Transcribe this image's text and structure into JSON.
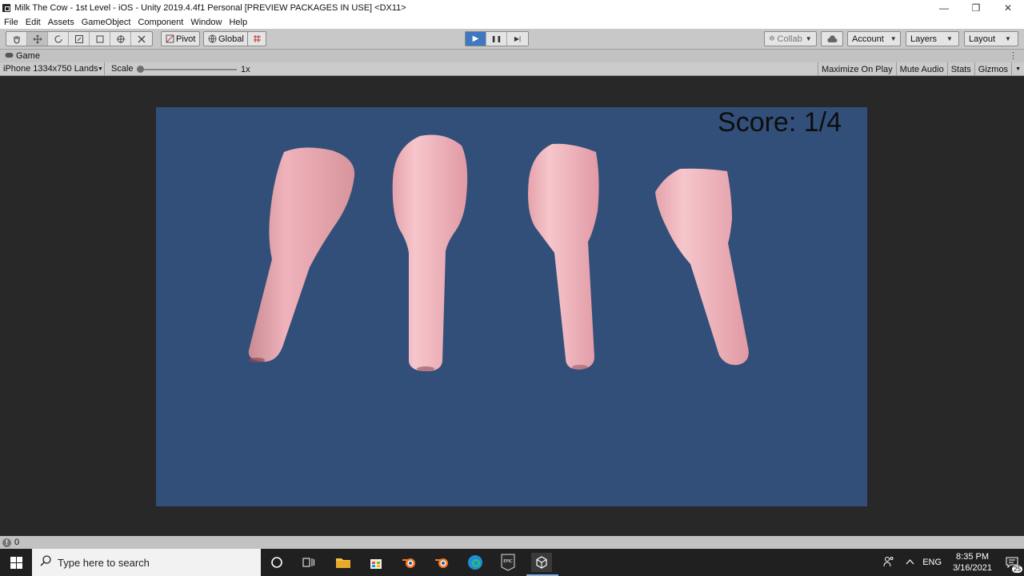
{
  "window": {
    "title": "Milk The Cow - 1st Level - iOS - Unity 2019.4.4f1 Personal [PREVIEW PACKAGES IN USE] <DX11>",
    "minimize": "—",
    "maximize": "❐",
    "close": "✕"
  },
  "menu": [
    "File",
    "Edit",
    "Assets",
    "GameObject",
    "Component",
    "Window",
    "Help"
  ],
  "toolbar": {
    "pivot_label": "Pivot",
    "global_label": "Global",
    "collab_label": "Collab",
    "account_label": "Account",
    "layers_label": "Layers",
    "layout_label": "Layout",
    "play_icon": "▶",
    "pause_icon": "❚❚",
    "step_icon": "▶|"
  },
  "game_tab": {
    "label": "Game"
  },
  "game_bar": {
    "resolution": "iPhone 1334x750 Lands",
    "scale_label": "Scale",
    "scale_value": "1x",
    "options": [
      "Maximize On Play",
      "Mute Audio",
      "Stats",
      "Gizmos"
    ]
  },
  "game": {
    "score_text": "Score: 1/4",
    "background_color": "#324f7a",
    "teat_color": "#eaa5ad"
  },
  "status": {
    "error_count": "0"
  },
  "taskbar": {
    "search_placeholder": "Type here to search",
    "language": "ENG",
    "time": "8:35 PM",
    "date": "3/16/2021",
    "notification_count": "25"
  },
  "colors": {
    "toolbar_bg": "#c8c8c8",
    "play_active": "#3d78c0",
    "viewport_bg": "#282828",
    "taskbar_bg": "#202020"
  }
}
